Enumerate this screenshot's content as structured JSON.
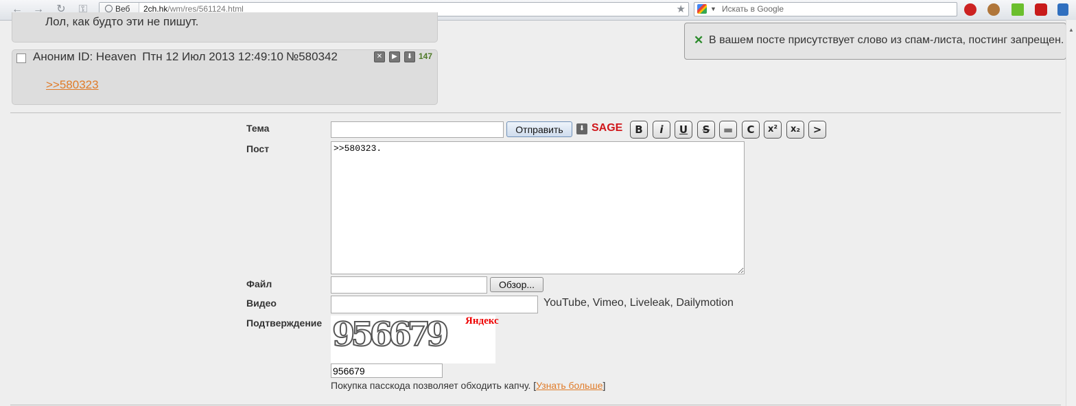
{
  "browser": {
    "web_label": "Веб",
    "url_host": "2ch.hk",
    "url_path": "/wm/res/561124.html",
    "search_placeholder": "Искать в Google"
  },
  "prev_reply": {
    "text": "Лол, как будто эти не пишут."
  },
  "reply": {
    "author": "Аноним ID: Heaven",
    "date": "Птн 12 Июл 2013 12:49:10",
    "number": "№580342",
    "count": "147",
    "link": ">>580323"
  },
  "toast": {
    "message": "В вашем посте присутствует слово из спам-листа, постинг запрещен."
  },
  "form": {
    "subject_label": "Тема",
    "subject_value": "",
    "submit_label": "Отправить",
    "sage_label": "SAGE",
    "post_label": "Пост",
    "post_value": ">>580323.",
    "file_label": "Файл",
    "browse_label": "Обзор...",
    "video_label": "Видео",
    "video_hint": "YouTube, Vimeo, Liveleak, Dailymotion",
    "captcha_label": "Подтверждение",
    "captcha_image_text": "956679",
    "captcha_provider": "Яндекс",
    "captcha_value": "956679",
    "passcode_text": "Покупка пасскода позволяет обходить капчу. [",
    "passcode_link": "Узнать больше",
    "passcode_end": "]"
  },
  "format_buttons": [
    "B",
    "i",
    "U",
    "S",
    "▬",
    "C",
    "x²",
    "x₂",
    ">"
  ],
  "colors": {
    "accent_link": "#e07b28",
    "sage": "#d0161a",
    "toast_icon": "#2b8a2b"
  }
}
